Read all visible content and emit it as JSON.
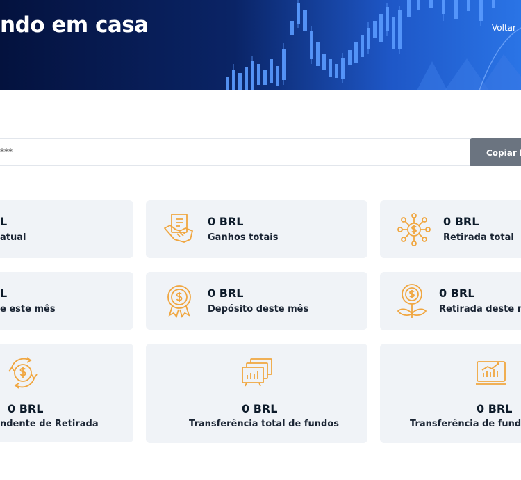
{
  "hero": {
    "title": "ndo em casa",
    "back_label": "Voltar"
  },
  "referral": {
    "link_masked": "***",
    "copy_label": "Copiar li"
  },
  "cards": [
    {
      "value": "L",
      "label": "atual",
      "icon": "wallet-icon"
    },
    {
      "value": "0 BRL",
      "label": "Ganhos totais",
      "icon": "handshake-icon"
    },
    {
      "value": "0 BRL",
      "label": "Retirada total",
      "icon": "dollar-network-icon"
    },
    {
      "value": "L",
      "label": "e este mês",
      "icon": "calendar-icon"
    },
    {
      "value": "0 BRL",
      "label": "Depósito deste mês",
      "icon": "dollar-badge-icon"
    },
    {
      "value": "0 BRL",
      "label": "Retirada deste mê",
      "icon": "money-plant-icon"
    },
    {
      "value": "0 BRL",
      "label": "ndente de Retirada",
      "icon": "dollar-cycle-icon"
    },
    {
      "value": "0 BRL",
      "label": "Transferência total de fundos",
      "icon": "transfer-chart-icon"
    },
    {
      "value": "0 BRL",
      "label": "Transferência de fundos",
      "icon": "monitor-chart-icon"
    }
  ],
  "colors": {
    "accent": "#f0a640",
    "card_bg": "#f0f3f7",
    "hero_dark": "#04123e",
    "button": "#6b7480"
  }
}
